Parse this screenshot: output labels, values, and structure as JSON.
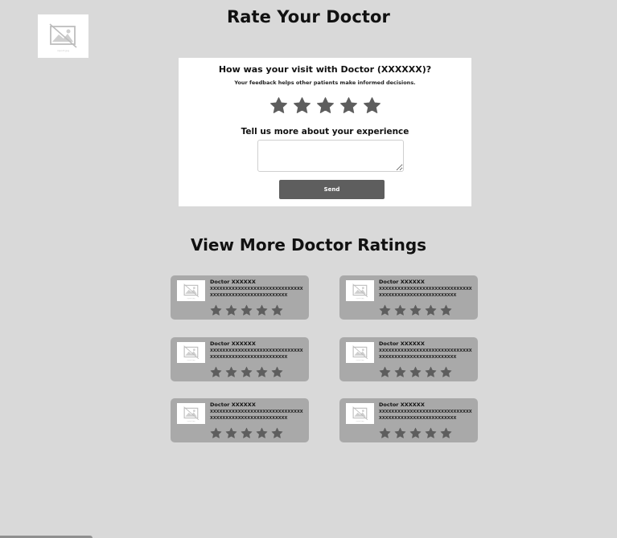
{
  "logo": {
    "caption": "report.jpg"
  },
  "page": {
    "title": "Rate Your Doctor"
  },
  "feedback": {
    "question": "How was your visit with Doctor (XXXXXX)?",
    "subtitle": "Your feedback helps other patients make informed decisions.",
    "rating": {
      "max": 5,
      "selected": 0
    },
    "experience_label": "Tell us more about your experience",
    "experience_value": "",
    "send_label": "Send"
  },
  "more_ratings": {
    "title": "View More Doctor Ratings",
    "doctors": [
      {
        "name": "Doctor XXXXXX",
        "description": "XXXXXXXXXXXXXXXXXXXXXXXXXXXXXXXXXXXXXXXXXXXXXXXXXXXXXXX",
        "image_caption": "report.jpg",
        "rating": 5
      },
      {
        "name": "Doctor XXXXXX",
        "description": "XXXXXXXXXXXXXXXXXXXXXXXXXXXXXXXXXXXXXXXXXXXXXXXXXXXXXXX",
        "image_caption": "report.jpg",
        "rating": 5
      },
      {
        "name": "Doctor XXXXXX",
        "description": "XXXXXXXXXXXXXXXXXXXXXXXXXXXXXXXXXXXXXXXXXXXXXXXXXXXXXXX",
        "image_caption": "report.jpg",
        "rating": 5
      },
      {
        "name": "Doctor XXXXXX",
        "description": "XXXXXXXXXXXXXXXXXXXXXXXXXXXXXXXXXXXXXXXXXXXXXXXXXXXXXXX",
        "image_caption": "report.jpg",
        "rating": 5
      },
      {
        "name": "Doctor XXXXXX",
        "description": "XXXXXXXXXXXXXXXXXXXXXXXXXXXXXXXXXXXXXXXXXXXXXXXXXXXXXXX",
        "image_caption": "report.jpg",
        "rating": 5
      },
      {
        "name": "Doctor XXXXXX",
        "description": "XXXXXXXXXXXXXXXXXXXXXXXXXXXXXXXXXXXXXXXXXXXXXXXXXXXXXXX",
        "image_caption": "report.jpg",
        "rating": 5
      }
    ]
  },
  "colors": {
    "background": "#d9d9d9",
    "card": "#ffffff",
    "doctor_card": "#a9a9a9",
    "star": "#5e5e5e",
    "button": "#5e5e5e"
  },
  "icons": {
    "logo": "image-placeholder-icon",
    "star": "star-icon",
    "doctor_photo": "image-placeholder-icon"
  }
}
